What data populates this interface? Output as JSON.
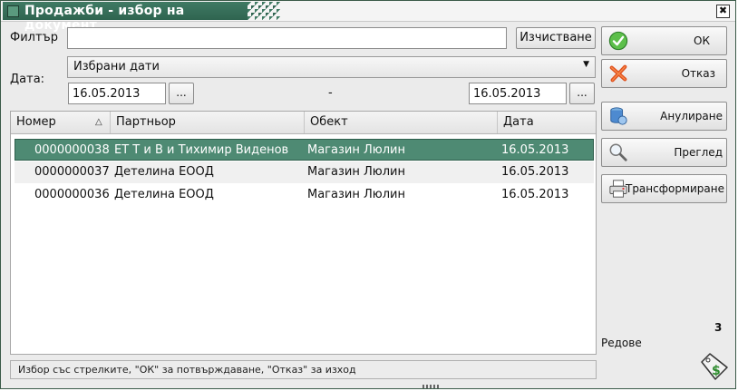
{
  "window": {
    "title": "Продажби - избор на документ",
    "close_glyph": "✖"
  },
  "filter": {
    "label": "Филтър",
    "value": "",
    "clear_label": "Изчистване"
  },
  "date": {
    "label": "Дата:",
    "mode_selected": "Избрани дати",
    "from": "16.05.2013",
    "to": "16.05.2013",
    "separator": "-",
    "picker_label": "..."
  },
  "grid": {
    "columns": [
      "Номер",
      "Партньор",
      "Обект",
      "Дата"
    ],
    "sorted_column": "Номер",
    "sort_direction": "ascending",
    "rows": [
      {
        "number": "0000000038",
        "partner": "ЕТ Т и В и Тихимир Виденов",
        "object": "Магазин Люлин",
        "date": "16.05.2013",
        "selected": true
      },
      {
        "number": "0000000037",
        "partner": "Детелина ЕООД",
        "object": "Магазин Люлин",
        "date": "16.05.2013",
        "selected": false
      },
      {
        "number": "0000000036",
        "partner": "Детелина ЕООД",
        "object": "Магазин Люлин",
        "date": "16.05.2013",
        "selected": false
      }
    ]
  },
  "status_text": "Избор със стрелките, \"ОК\" за потвърждаване, \"Отказ\" за изход",
  "actions": {
    "ok": "ОК",
    "cancel": "Отказ",
    "void": "Анулиране",
    "preview": "Преглед",
    "transform": "Трансформиране"
  },
  "rows_info": {
    "count": "3",
    "label": "Редове"
  },
  "icons": {
    "ok": "check-icon",
    "cancel": "x-icon",
    "void": "database-icon",
    "preview": "magnifier-icon",
    "transform": "printer-icon",
    "tag": "price-tag-icon"
  },
  "colors": {
    "title_bar": "#3f7a63",
    "selection": "#4e8a73",
    "ok_green": "#3aa43a",
    "cancel_red": "#d9421c"
  }
}
